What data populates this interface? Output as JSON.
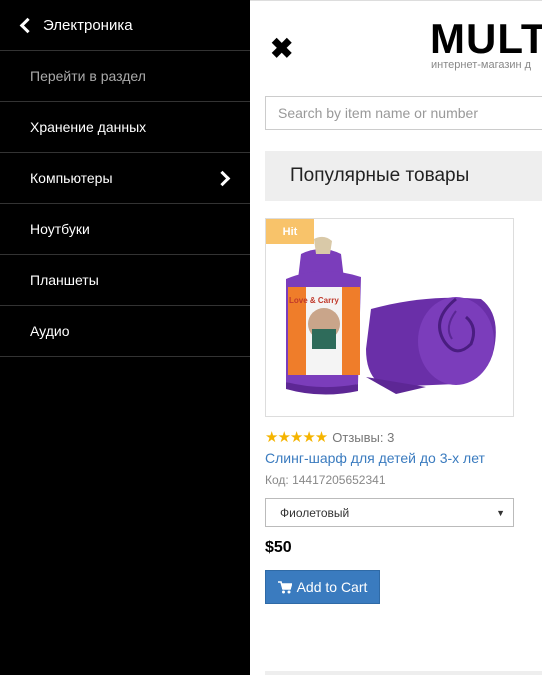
{
  "sidebar": {
    "back_label": "Электроника",
    "items": [
      {
        "label": "Перейти в раздел"
      },
      {
        "label": "Хранение данных"
      },
      {
        "label": "Компьютеры"
      },
      {
        "label": "Ноутбуки"
      },
      {
        "label": "Планшеты"
      },
      {
        "label": "Аудио"
      }
    ]
  },
  "header": {
    "close_symbol": "✖",
    "logo": "MULTIS",
    "tagline": "интернет-магазин д"
  },
  "search": {
    "placeholder": "Search by item name or number"
  },
  "section_title": "Популярные товары",
  "product": {
    "badge": "Hit",
    "rating_stars": 5,
    "reviews_label": "Отзывы: 3",
    "title": "Слинг-шарф для детей до 3-х лет",
    "code": "Код: 14417205652341",
    "option_selected": "Фиолетовый",
    "price": "$50",
    "add_to_cart": "Add to Cart",
    "package_text": "Love & Carry"
  },
  "colors": {
    "accent": "#3a7bbf",
    "badge": "#f8c36a",
    "star": "#f5b400",
    "product_purple": "#6a2fa8"
  }
}
